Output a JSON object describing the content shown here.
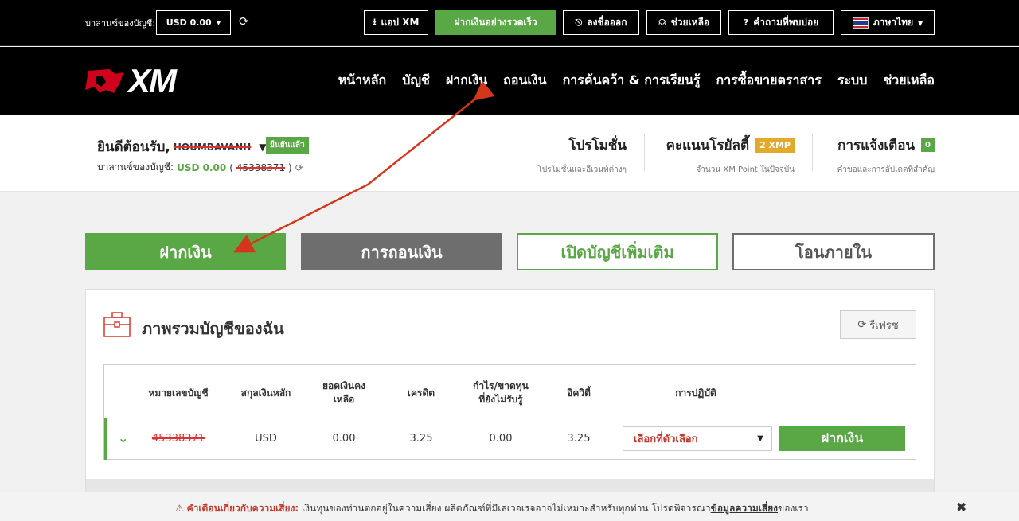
{
  "topbar": {
    "balance_label": "บาลานซ์ของบัญชี:",
    "balance_value": "USD 0.00",
    "buttons": {
      "xm_app": "แอป XM",
      "fast_deposit": "ฝากเงินอย่างรวดเร็ว",
      "logout": "ลงชื่อออก",
      "help": "ช่วยเหลือ",
      "faq": "คำถามที่พบบ่อย",
      "language": "ภาษาไทย"
    }
  },
  "logo": {
    "text": "XM"
  },
  "nav": {
    "items": [
      "หน้าหลัก",
      "บัญชี",
      "ฝากเงิน",
      "ถอนเงิน",
      "การค้นคว้า & การเรียนรู้",
      "การซื้อขายตราสาร",
      "ระบบ",
      "ช่วยเหลือ"
    ]
  },
  "welcome": {
    "greeting": "ยินดีต้อนรับ,",
    "name": "HOUMBAVANH",
    "verified": "ยืนยันแล้ว",
    "balance_label": "บาลานซ์ของบัญชี:",
    "balance_value": "USD 0.00",
    "account_id": "45338371",
    "promotions": {
      "title": "โปรโมชั่น",
      "subtitle": "โปรโมชั่นและอีเวนท์ต่างๆ"
    },
    "loyalty": {
      "title": "คะแนนโรยัลตี้",
      "badge": "2 XMP",
      "subtitle": "จำนวน XM Point ในปัจจุบัน"
    },
    "notifications": {
      "title": "การแจ้งเตือน",
      "badge": "0",
      "subtitle": "คำขอและการอัปเดตที่สำคัญ"
    }
  },
  "actions": {
    "deposit": "ฝากเงิน",
    "withdraw": "การถอนเงิน",
    "open_account": "เปิดบัญชีเพิ่มเติม",
    "internal_transfer": "โอนภายใน"
  },
  "panel": {
    "title": "ภาพรวมบัญชีของฉัน",
    "refresh": "รีเฟรช",
    "table": {
      "headers": {
        "account_number": "หมายเลขบัญชี",
        "base_currency": "สกุลเงินหลัก",
        "balance_1": "ยอดเงินคง",
        "balance_2": "เหลือ",
        "credit": "เครดิต",
        "pnl_1": "กำไร/ขาดทุน",
        "pnl_2": "ที่ยังไม่รับรู้",
        "equity": "อิควิตี้",
        "actions": "การปฏิบัติ"
      },
      "rows": [
        {
          "account_number": "45338371",
          "currency": "USD",
          "balance": "0.00",
          "credit": "3.25",
          "pnl": "0.00",
          "equity": "3.25",
          "select_placeholder": "เลือกที่ตัวเลือก",
          "deposit": "ฝากเงิน"
        }
      ]
    }
  },
  "risk": {
    "warning_label": "คำเตือนเกี่ยวกับความเสี่ยง:",
    "text": "เงินทุนของท่านตกอยู่ในความเสี่ยง ผลิตภัณฑ์ที่มีเลเวอเรจอาจไม่เหมาะสำหรับทุกท่าน โปรดพิจารณา",
    "link": "ข้อมูลความเสี่ยง",
    "suffix": "ของเรา",
    "close": "✖"
  },
  "colors": {
    "accent_green": "#5aa745",
    "annotation_red": "#d4361c",
    "badge_orange": "#e3a92b"
  }
}
